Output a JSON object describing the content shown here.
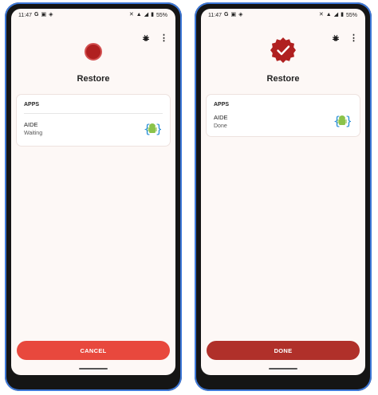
{
  "left": {
    "status_bar": {
      "time": "11:47",
      "battery": "55%",
      "left_icons": [
        "G",
        "▣",
        "◈"
      ]
    },
    "title": "Restore",
    "section_header": "APPS",
    "app": {
      "name": "AIDE",
      "status": "Waiting",
      "icon": "android-icon"
    },
    "button_label": "CANCEL",
    "status_indicator": "in-progress",
    "colors": {
      "accent": "#e8483d",
      "indicator": "#b02020"
    }
  },
  "right": {
    "status_bar": {
      "time": "11:47",
      "battery": "55%",
      "left_icons": [
        "G",
        "▣",
        "◈"
      ]
    },
    "title": "Restore",
    "section_header": "APPS",
    "app": {
      "name": "AIDE",
      "status": "Done",
      "icon": "android-icon"
    },
    "button_label": "DONE",
    "status_indicator": "complete-check",
    "colors": {
      "accent": "#b0302a",
      "indicator": "#b02020"
    }
  }
}
